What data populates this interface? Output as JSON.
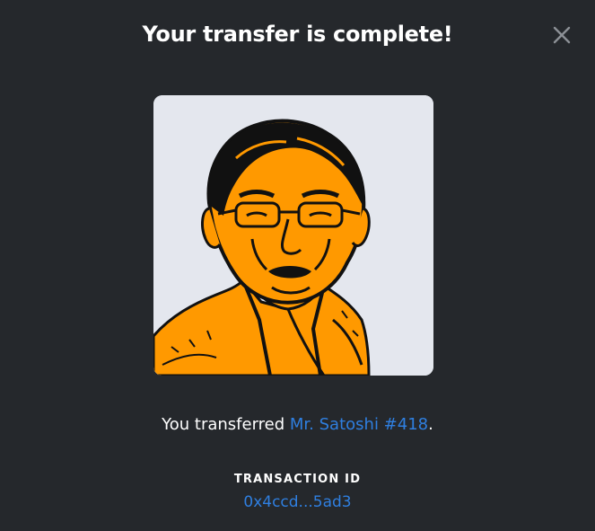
{
  "modal": {
    "title": "Your transfer is complete!",
    "close_icon": "close-icon"
  },
  "nft": {
    "image_icon": "portrait-image",
    "colors": {
      "background": "#e4e7ee",
      "accent": "#ff9900",
      "ink": "#111111"
    }
  },
  "transfer": {
    "prefix": "You transferred ",
    "item_name": "Mr. Satoshi #418",
    "suffix": "."
  },
  "transaction": {
    "label": "TRANSACTION ID",
    "id": "0x4ccd...5ad3"
  },
  "colors": {
    "background": "#25282c",
    "text": "#ffffff",
    "link": "#2f7fe0"
  }
}
